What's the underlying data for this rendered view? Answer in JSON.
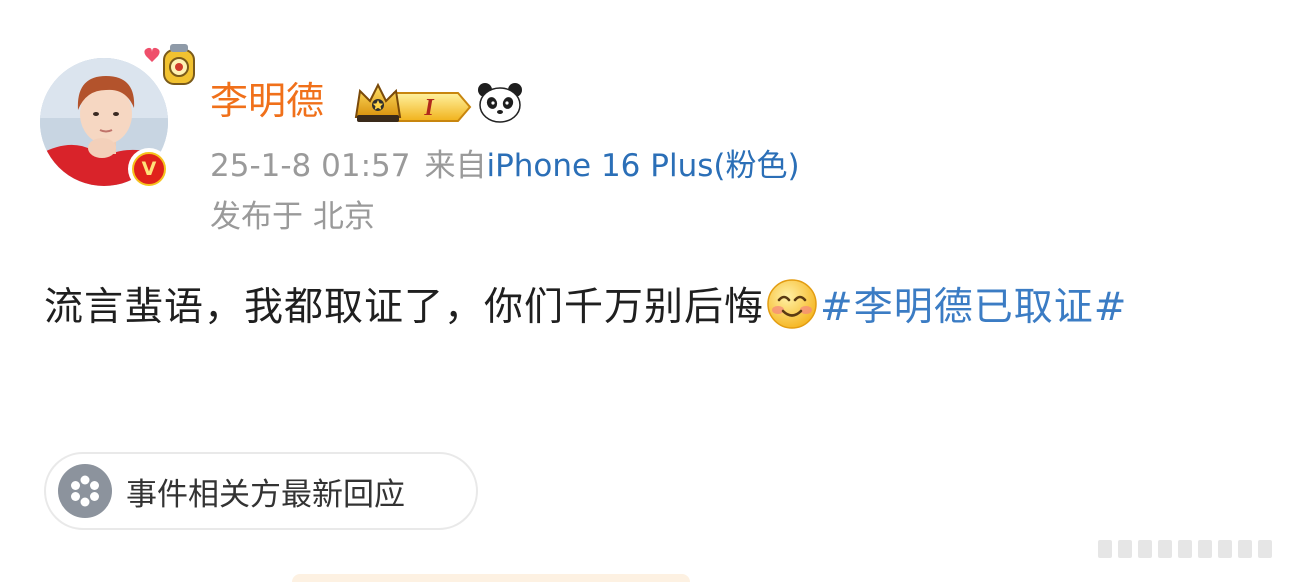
{
  "post": {
    "author": {
      "name": "李明德",
      "verified_mark": "V",
      "vip_level": "I",
      "icons": [
        "avatar-pendant-icon",
        "crown-vip-icon",
        "panda-icon"
      ]
    },
    "meta": {
      "datetime": "25-1-8 01:57",
      "source_prefix": "来自",
      "device": "iPhone 16 Plus(粉色)",
      "location": "发布于 北京"
    },
    "content": {
      "text": "流言蜚语，我都取证了，你们千万别后悔",
      "emoji": "smile-emoji-icon",
      "hashtag": "#李明德已取证#"
    },
    "event_card": {
      "label": "事件相关方最新回应",
      "icon": "flower-icon"
    }
  },
  "colors": {
    "username": "#f0701a",
    "link": "#2b6fb7",
    "hashtag": "#3b7cc4",
    "meta": "#9a9a9a",
    "verified": "#e0221b"
  }
}
